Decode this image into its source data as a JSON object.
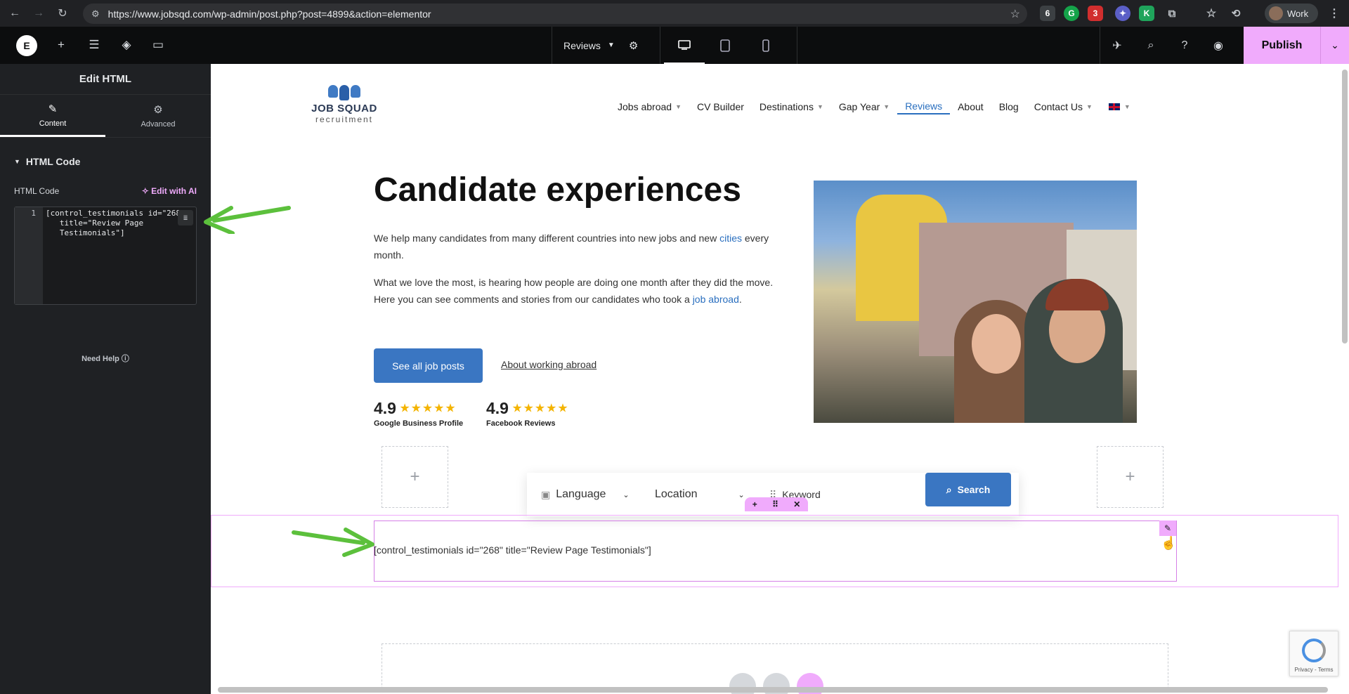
{
  "browser": {
    "url": "https://www.jobsqd.com/wp-admin/post.php?post=4899&action=elementor",
    "profile_label": "Work",
    "ext_badges": [
      "6",
      "3"
    ]
  },
  "editor": {
    "page_name": "Reviews",
    "publish_label": "Publish"
  },
  "panel": {
    "title": "Edit HTML",
    "tabs": [
      {
        "label": "Content"
      },
      {
        "label": "Advanced"
      }
    ],
    "section_label": "HTML Code",
    "control_label": "HTML Code",
    "edit_ai_label": "Edit with AI",
    "line_number": "1",
    "code": "[control_testimonials id=\"268\"\n   title=\"Review Page\n   Testimonials\"]",
    "need_help": "Need Help"
  },
  "site": {
    "logo_line1": "JOB SQUAD",
    "logo_line2": "recruitment",
    "menu": [
      {
        "label": "Jobs abroad",
        "caret": true
      },
      {
        "label": "CV Builder",
        "caret": false
      },
      {
        "label": "Destinations",
        "caret": true
      },
      {
        "label": "Gap Year",
        "caret": true
      },
      {
        "label": "Reviews",
        "caret": false
      },
      {
        "label": "About",
        "caret": false
      },
      {
        "label": "Blog",
        "caret": false
      },
      {
        "label": "Contact Us",
        "caret": true
      }
    ],
    "hero_title": "Candidate experiences",
    "p1_before": "We help many candidates from many different countries into new jobs and new ",
    "p1_link": "cities",
    "p1_after": " every month.",
    "p2_before": "What we love the most, is hearing how people are doing one month after they did the move. Here you can see comments and stories from our candidates who took a ",
    "p2_link": "job abroad",
    "p2_after": ".",
    "btn_primary": "See all job posts",
    "btn_link": "About working abroad",
    "ratings": [
      {
        "score": "4.9",
        "stars": "★★★★★",
        "source": "Google Business Profile"
      },
      {
        "score": "4.9",
        "stars": "★★★★★",
        "source": "Facebook Reviews"
      }
    ],
    "search": {
      "language": "Language",
      "location": "Location",
      "keyword_placeholder": "Keyword",
      "button": "Search"
    },
    "shortcode": "[control_testimonials id=\"268\" title=\"Review Page Testimonials\"]",
    "recaptcha_text": "Privacy - Terms"
  },
  "colors": {
    "accent": "#f0abfc",
    "link": "#2a6fbf",
    "button": "#3a76c2",
    "arrow": "#5cc03c"
  }
}
